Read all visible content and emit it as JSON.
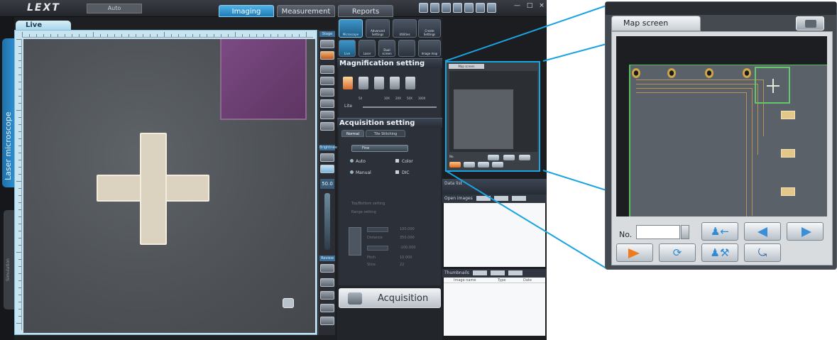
{
  "topbar": {
    "logo": "LEXT",
    "app_tab": "Auto",
    "modes": [
      {
        "label": "Imaging",
        "active": true
      },
      {
        "label": "Measurement",
        "active": false
      },
      {
        "label": "Reports",
        "active": false
      }
    ],
    "window_controls": "— □ ×"
  },
  "left_strip": {
    "primary_tab": "Laser microscope",
    "secondary_tab": "Simulation"
  },
  "live": {
    "tab_label": "Live"
  },
  "toolcol": {
    "head_top": "Stage",
    "head_mid": "Brightness",
    "magnification": "50.0",
    "head_bottom": "Review"
  },
  "control_panel": {
    "big_tabs": [
      "Microscope",
      "Advanced Settings",
      "Utilities",
      "Create Settings",
      ""
    ],
    "sub_tabs": [
      "Live",
      "Laser",
      "Dual screen",
      "",
      "Image map"
    ],
    "magnification_setting": {
      "title": "Magnification setting",
      "scale_labels": [
        "5X",
        "10X",
        "20X",
        "50X",
        "100X"
      ],
      "zoom_label": "Lite"
    },
    "acquisition_setting": {
      "title": "Acquisition setting",
      "tabs": [
        "Normal",
        "Tile Stitching"
      ],
      "mode_value": "Fine",
      "radios": [
        "Auto",
        "Manual"
      ],
      "checks": [
        "Color",
        "DIC"
      ],
      "faint_options": [
        "Top/Bottom setting",
        "Range setting"
      ],
      "fields": [
        {
          "label": "",
          "value": "100.000"
        },
        {
          "label": "Distance",
          "value": "350.000"
        },
        {
          "label": "",
          "value": "-100.000"
        },
        {
          "label": "Pitch",
          "value": "10.000"
        },
        {
          "label": "Slice",
          "value": "22"
        }
      ]
    },
    "acquisition_button": "Acquisition"
  },
  "side": {
    "mini_map_title": "Map screen",
    "mini_map_no_label": "No.",
    "dock_title": "Data list",
    "open_images_label": "Open images",
    "open_images_buttons": [
      "Analyze",
      "Report",
      "Close"
    ],
    "notes_label": "Thumbnails",
    "notes_buttons": [
      "Analyze",
      "Report",
      "Delete"
    ],
    "table_headers": [
      "Image name",
      "Type",
      "Date"
    ]
  },
  "map_window": {
    "tab_label": "Map screen",
    "no_label": "No.",
    "no_value": ""
  },
  "colors": {
    "accent": "#1ba4e0",
    "active_tab": "#1e7cb6",
    "selection_box": "#64c76a",
    "orange_button": "#f07b1d",
    "arrow_blue": "#3b8ed8"
  }
}
